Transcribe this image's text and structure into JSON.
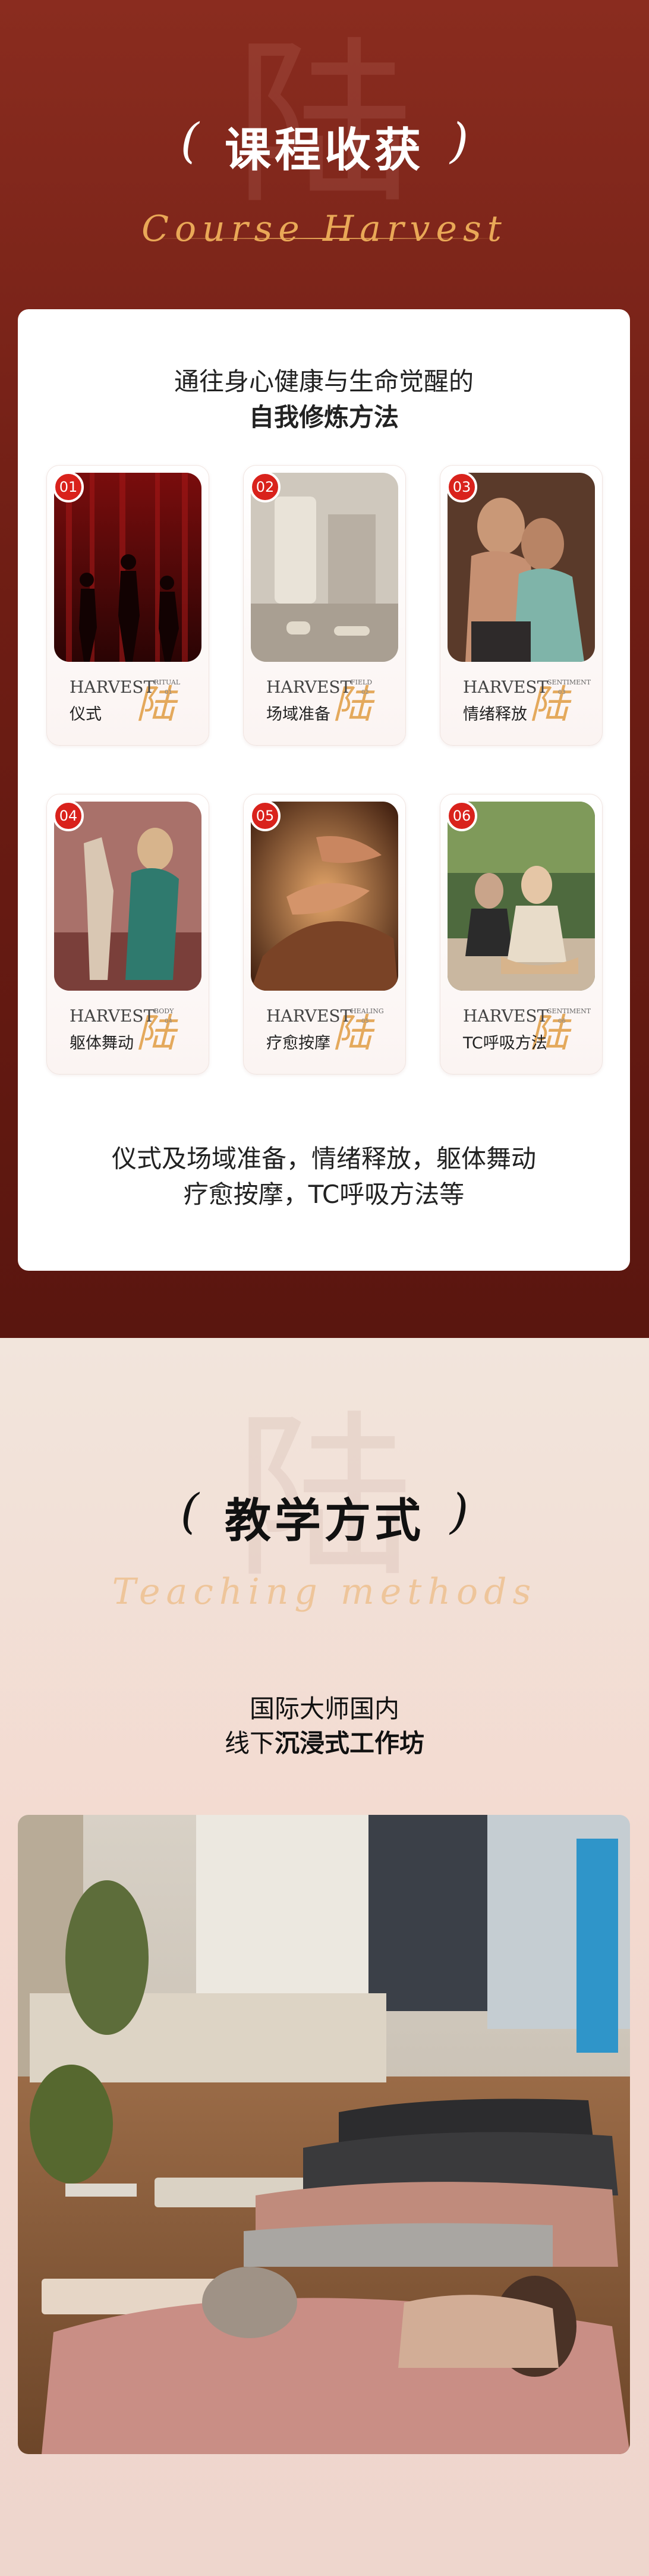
{
  "colors": {
    "accent_red": "#d9221c",
    "gold": "#e4a95c",
    "dark_red": "#6e1d14"
  },
  "section1": {
    "bg_char": "陆",
    "title": "课程收获",
    "paren_left": "(",
    "paren_right": ")",
    "script": "Course Harvest",
    "card": {
      "subtitle_line1": "通往身心健康与生命觉醒的",
      "subtitle_line2": "自我修炼方法",
      "items": [
        {
          "num": "01",
          "harvest": "HARVEST",
          "tag": "RITUAL",
          "tag_num": "01",
          "callig": "陆",
          "name": "仪式",
          "photo": "dancers-silhouette"
        },
        {
          "num": "02",
          "harvest": "HARVEST",
          "tag": "FIELD",
          "tag_num": "02",
          "callig": "陆",
          "name": "场域准备",
          "photo": "studio-room"
        },
        {
          "num": "03",
          "harvest": "HARVEST",
          "tag": "SENTIMENT",
          "tag_num": "03",
          "callig": "陆",
          "name": "情绪释放",
          "photo": "couple-embrace"
        },
        {
          "num": "04",
          "harvest": "HARVEST",
          "tag": "BODY",
          "tag_num": "04",
          "callig": "陆",
          "name": "躯体舞动",
          "photo": "dance-movement"
        },
        {
          "num": "05",
          "harvest": "HARVEST",
          "tag": "HEALING",
          "tag_num": "05",
          "callig": "陆",
          "name": "疗愈按摩",
          "photo": "massage-hands"
        },
        {
          "num": "06",
          "harvest": "HARVEST",
          "tag": "SENTIMENT",
          "tag_num": "06",
          "callig": "陆",
          "name": "TC呼吸方法",
          "photo": "breathing-circle"
        }
      ],
      "footer_line1": "仪式及场域准备，情绪释放，躯体舞动",
      "footer_line2": "疗愈按摩，TC呼吸方法等"
    }
  },
  "section2": {
    "bg_char": "陆",
    "title": "教学方式",
    "paren_left": "(",
    "paren_right": ")",
    "script": "Teaching methods",
    "subtitle_line1": "国际大师国内",
    "subtitle_line2_prefix": "线下",
    "subtitle_line2_bold": "沉浸式工作坊"
  }
}
